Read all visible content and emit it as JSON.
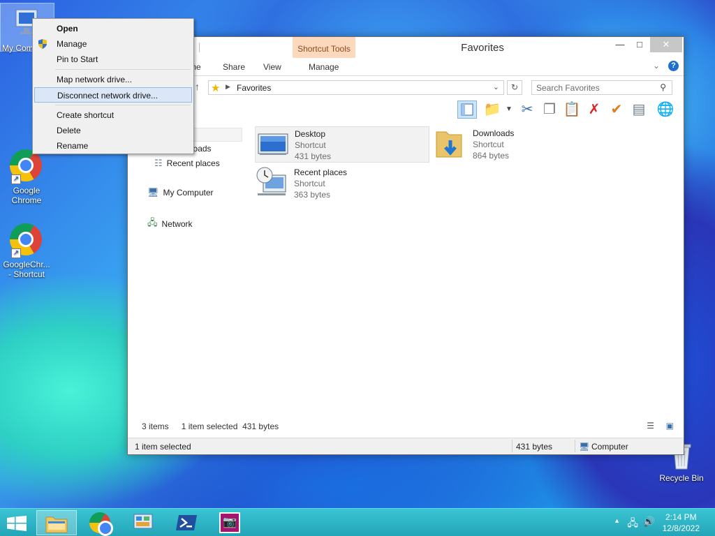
{
  "desktop": {
    "icons": [
      {
        "label": "My Com"
      },
      {
        "label": "Google Chrome"
      },
      {
        "label": "GoogleChr... - Shortcut"
      }
    ],
    "recycle_bin": "Recycle Bin"
  },
  "window": {
    "title": "Favorites",
    "contextual_tab_group": "Shortcut Tools",
    "ribbon_tabs": [
      "me",
      "Share",
      "View",
      "Manage"
    ],
    "address": {
      "path": "Favorites"
    },
    "search": {
      "placeholder": "Search Favorites"
    },
    "nav_pane": {
      "items": [
        {
          "label": "p"
        },
        {
          "label": "Downloads"
        },
        {
          "label": "Recent places"
        },
        {
          "label": "My Computer"
        },
        {
          "label": "Network"
        }
      ]
    },
    "files": [
      {
        "name": "Desktop",
        "type": "Shortcut",
        "size": "431 bytes",
        "selected": true
      },
      {
        "name": "Downloads",
        "type": "Shortcut",
        "size": "864 bytes",
        "selected": false
      },
      {
        "name": "Recent places",
        "type": "Shortcut",
        "size": "363 bytes",
        "selected": false
      }
    ],
    "status": {
      "items_count": "3 items",
      "selected_info": "1 item selected",
      "selected_size": "431 bytes",
      "bottom_left": "1 item selected",
      "bottom_size": "431 bytes",
      "bottom_location": "Computer"
    }
  },
  "context_menu": {
    "items": [
      {
        "label": "Open"
      },
      {
        "label": "Manage"
      },
      {
        "label": "Pin to Start"
      },
      {
        "label": "Map network drive..."
      },
      {
        "label": "Disconnect network drive..."
      },
      {
        "label": "Create shortcut"
      },
      {
        "label": "Delete"
      },
      {
        "label": "Rename"
      }
    ]
  },
  "taskbar": {
    "clock_time": "2:14 PM",
    "clock_date": "12/8/2022"
  },
  "colors": {
    "taskbar": "#2fb8c9",
    "shortcut_tools_tab": "#fcd9bd",
    "menu_highlight": "#dbe7f7"
  }
}
